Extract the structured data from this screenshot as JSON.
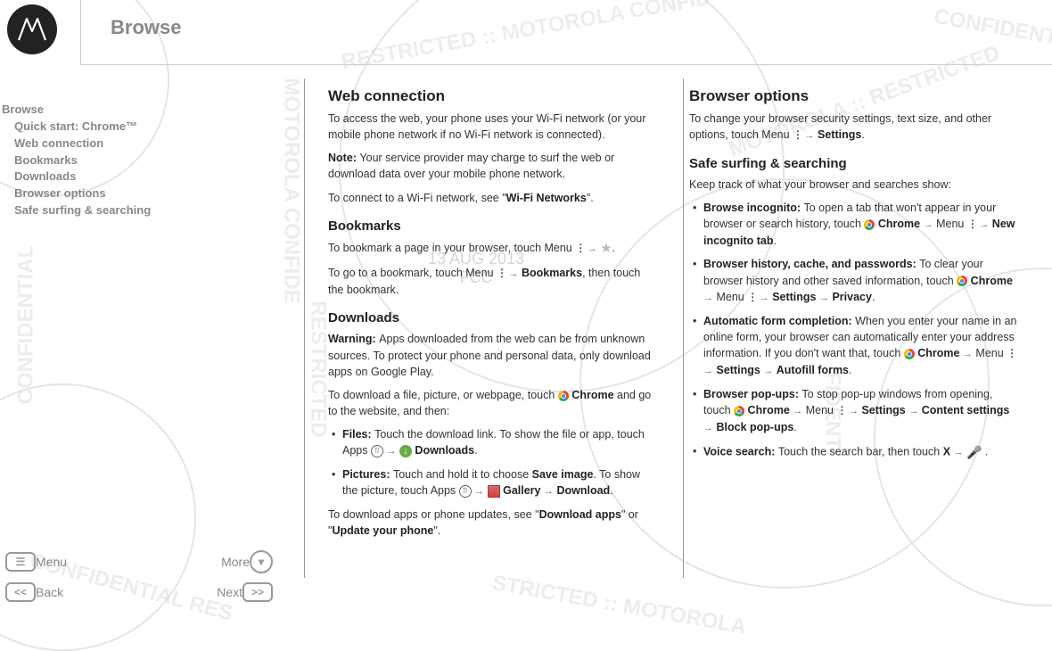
{
  "page_title": "Browse",
  "sidebar": {
    "title": "Browse",
    "items": [
      "Quick start: Chrome™",
      "Web connection",
      "Bookmarks",
      "Downloads",
      "Browser options",
      "Safe surfing & searching"
    ]
  },
  "watermark_center": {
    "line1": "13 AUG 2013",
    "line2": "FCC"
  },
  "watermarks": [
    "RESTRICTED :: MOTOROLA CONFID",
    "CONFIDENTIAL RES",
    "MOTOROLA CONFIDE",
    "CONFIDENTIAL",
    "RESTRICTED",
    "CONFIDENTIAL RES",
    "STRICTED :: MOTOROLA",
    "FIDENTI",
    "CO",
    "MOTOROLA :: RESTRICTED"
  ],
  "col1": {
    "h1": "Web connection",
    "p1": "To access the web, your phone uses your Wi-Fi network (or your mobile phone network if no Wi-Fi network is connected).",
    "p2a": "Note: ",
    "p2b": "Your service provider may charge to surf the web or download data over your mobile phone network.",
    "p3a": "To connect to a Wi-Fi network, see \"",
    "p3b": "Wi-Fi Networks",
    "p3c": "\".",
    "h2": "Bookmarks",
    "p4": "To bookmark a page in your browser, touch Menu ",
    "p5a": "To go to a bookmark, touch Menu ",
    "p5b": "Bookmarks",
    "p5c": ", then touch the bookmark.",
    "h3": "Downloads",
    "p6a": "Warning: ",
    "p6b": "Apps downloaded from the web can be from unknown sources. To protect your phone and personal data, only download apps on Google Play.",
    "p7a": "To download a file, picture, or webpage, touch ",
    "p7b": "Chrome",
    "p7c": " and go to the website, and then:",
    "li1a": "Files: ",
    "li1b": "Touch the download link. To show the file or app, touch Apps ",
    "li1c": "Downloads",
    "li2a": "Pictures: ",
    "li2b": "Touch and hold it to choose ",
    "li2c": "Save image",
    "li2d": ". To show the picture, touch Apps ",
    "li2e": "Gallery",
    "li2f": "Download",
    "p8a": "To download apps or phone updates, see \"",
    "p8b": "Download apps",
    "p8c": "\" or \"",
    "p8d": "Update your phone",
    "p8e": "\"."
  },
  "col2": {
    "h1": "Browser options",
    "p1a": "To change your browser security settings, text size, and other options, touch Menu ",
    "p1b": "Settings",
    "h2": "Safe surfing & searching",
    "p2": "Keep track of what your browser and searches show:",
    "li1a": "Browse incognito: ",
    "li1b": "To open a tab that won't appear in your browser or search history, touch ",
    "li1c": "Chrome",
    "li1d": " Menu ",
    "li1e": "New incognito tab",
    "li2a": "Browser history, cache, and passwords: ",
    "li2b": "To clear your browser history and other saved information, touch ",
    "li2c": "Chrome",
    "li2d": " Menu ",
    "li2e": "Settings",
    "li2f": "Privacy",
    "li3a": "Automatic form completion: ",
    "li3b": "When you enter your name in an online form, your browser can automatically enter your address information. If you don't want that, touch ",
    "li3c": "Chrome",
    "li3d": " Menu ",
    "li3e": "Settings",
    "li3f": "Autofill forms",
    "li4a": "Browser pop-ups: ",
    "li4b": "To stop pop-up windows from opening, touch ",
    "li4c": "Chrome",
    "li4d": " Menu ",
    "li4e": "Settings",
    "li4f": "Content settings",
    "li4g": "Block pop-ups",
    "li5a": "Voice search: ",
    "li5b": "Touch the search bar, then touch ",
    "li5c": "X"
  },
  "nav": {
    "menu": "Menu",
    "more": "More",
    "back": "Back",
    "next": "Next"
  }
}
